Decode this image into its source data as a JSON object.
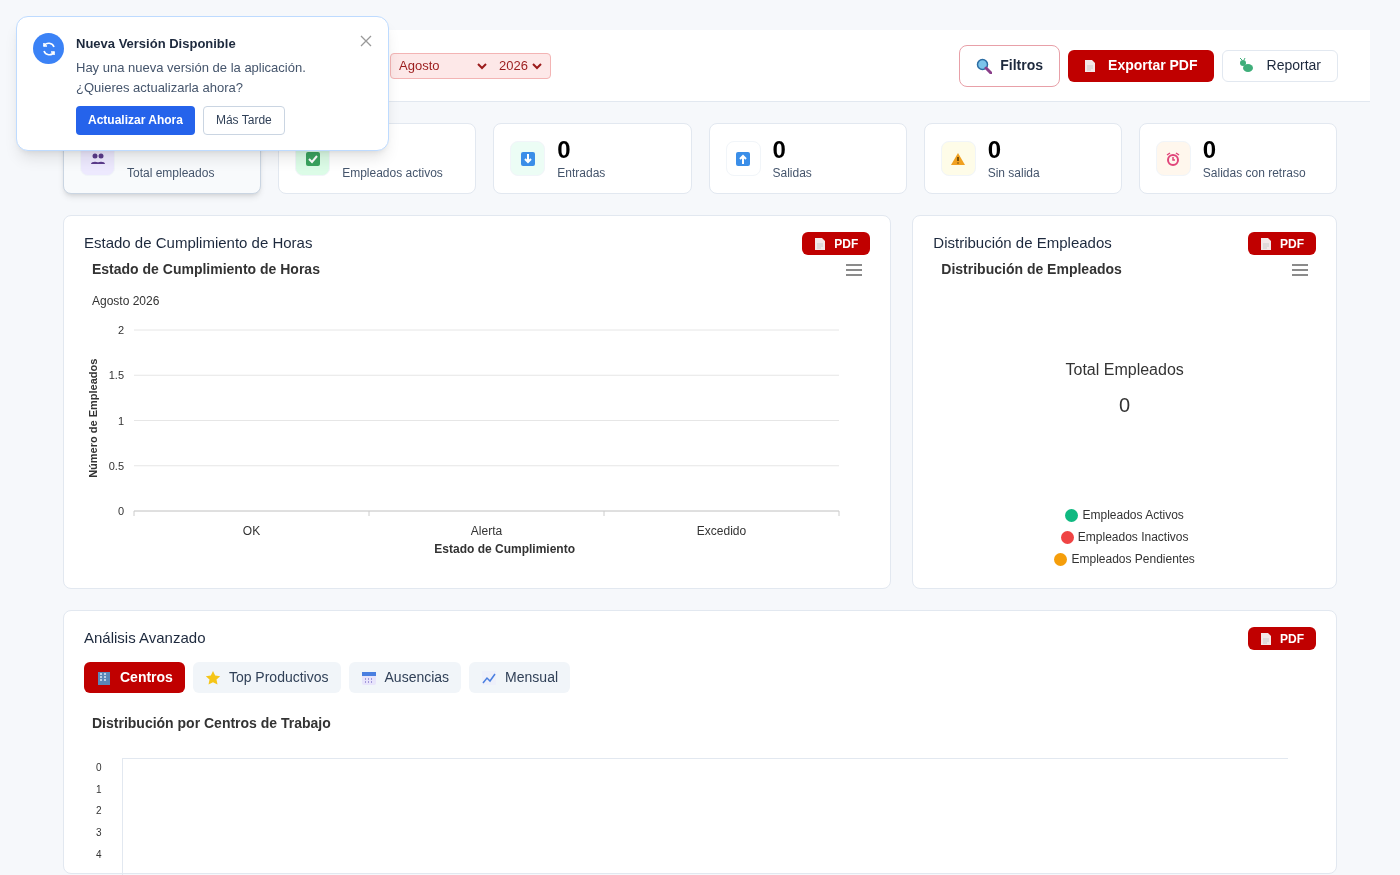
{
  "header": {
    "month": "Agosto",
    "year": "2026",
    "actions": [
      {
        "kind": "outline",
        "label": "Filtros"
      },
      {
        "kind": "primary",
        "label": "Exportar PDF"
      },
      {
        "kind": "plain",
        "label": "Reportar"
      }
    ]
  },
  "stats": [
    {
      "label": "Total empleados",
      "kind": "people",
      "selected": true
    },
    {
      "label": "Empleados activos",
      "kind": "check",
      "selected": false
    },
    {
      "value": "0",
      "label": "Entradas",
      "kind": "down",
      "selected": false
    },
    {
      "value": "0",
      "label": "Salidas",
      "kind": "up",
      "selected": false
    },
    {
      "value": "0",
      "label": "Sin salida",
      "kind": "warning",
      "selected": false
    },
    {
      "value": "0",
      "label": "Salidas con retraso",
      "kind": "alarm",
      "selected": false
    }
  ],
  "compliance_card": {
    "title": "Estado de Cumplimiento de Horas",
    "pdf_label": "PDF",
    "subtitle": "Agosto 2026",
    "chart_data": {
      "type": "bar",
      "title": "Estado de Cumplimiento de Horas",
      "xlabel": "Estado de Cumplimiento",
      "ylabel": "Número de Empleados",
      "categories": [
        "OK",
        "Alerta",
        "Excedido"
      ],
      "values": [
        0,
        0,
        0
      ],
      "ylim": [
        0,
        2
      ],
      "yticks": [
        0,
        0.5,
        1,
        1.5,
        2
      ],
      "grid": true
    }
  },
  "distribution_card": {
    "title": "Distribución de Empleados",
    "pdf_label": "PDF",
    "center_label": "Total Empleados",
    "center_value": "0",
    "chart_title": "Distribución de Empleados",
    "legend": [
      {
        "label": "Empleados Activos",
        "color": "#10b981"
      },
      {
        "label": "Empleados Inactivos",
        "color": "#ef4444"
      },
      {
        "label": "Empleados Pendientes",
        "color": "#f59e0b"
      }
    ]
  },
  "advanced_card": {
    "title": "Análisis Avanzado",
    "pdf_label": "PDF",
    "tabs": [
      {
        "label": "Centros",
        "kind": "building",
        "selected": true
      },
      {
        "label": "Top Productivos",
        "kind": "star",
        "selected": false
      },
      {
        "label": "Ausencias",
        "kind": "calendar",
        "selected": false
      },
      {
        "label": "Mensual",
        "kind": "trend",
        "selected": false
      }
    ],
    "chart": {
      "title": "Distribución por Centros de Trabajo",
      "axis_labels": [
        "0",
        "1",
        "2",
        "3",
        "4"
      ]
    }
  },
  "update_popup": {
    "title": "Nueva Versión Disponible",
    "message": "Hay una nueva versión de la aplicación. ¿Quieres actualizarla ahora?",
    "primary": "Actualizar Ahora",
    "secondary": "Más Tarde"
  }
}
